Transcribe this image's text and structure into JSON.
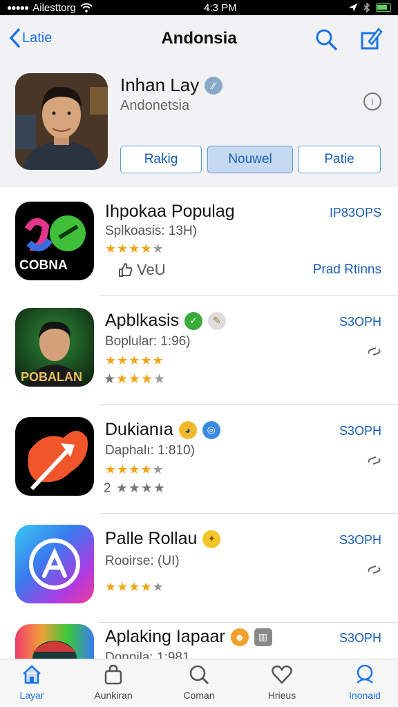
{
  "status_bar": {
    "carrier": "Ailesttorg",
    "time": "4:3 PM"
  },
  "nav": {
    "back_label": "Latie",
    "title": "Andonsia"
  },
  "profile": {
    "name": "Inhan Lay",
    "subtitle": "Andonetsia",
    "info_glyph": "i"
  },
  "segments": [
    {
      "label": "Rakig",
      "active": false
    },
    {
      "label": "Nouwel",
      "active": true
    },
    {
      "label": "Patie",
      "active": false
    }
  ],
  "apps": [
    {
      "name": "Ihpokaa Populag",
      "subtitle": "Splkoasis: 13H)",
      "icon_text": "COBNA",
      "rating_stars": 4,
      "secondary_text": "VeU",
      "price": "IP83OPS",
      "action_text": "Prad Rtinns"
    },
    {
      "name": "Apblkasis",
      "subtitle": "Boplular: 1:96)",
      "icon_text": "POBALAN",
      "rating_stars": 5,
      "second_rating_stars": 4,
      "price": "S3OPH"
    },
    {
      "name": "Dukianıa",
      "subtitle": "Daphalı: 1:810)",
      "icon_text": "",
      "rating_stars": 4,
      "second_rating_prefix": "2",
      "second_rating_stars": 4,
      "price": "S3OPH"
    },
    {
      "name": "Palle Rollau",
      "subtitle": "Rooirse: (UI)",
      "icon_text": "",
      "rating_stars": 4,
      "price": "S3OPH"
    },
    {
      "name": "Aplaking Iapaar",
      "subtitle": "Donnila: 1:981",
      "icon_text": "",
      "price": "S3OPH"
    }
  ],
  "tabs": [
    {
      "label": "Layar",
      "icon": "house-icon",
      "active": true
    },
    {
      "label": "Aunkiran",
      "icon": "bag-icon",
      "active": false
    },
    {
      "label": "Coman",
      "icon": "search-icon",
      "active": false
    },
    {
      "label": "Hrieus",
      "icon": "heart-icon",
      "active": false
    },
    {
      "label": "Inonaid",
      "icon": "person-icon",
      "active": true
    }
  ],
  "colors": {
    "accent": "#1a73e8",
    "star": "#f2a518",
    "header_bg": "#f2f2f4"
  }
}
